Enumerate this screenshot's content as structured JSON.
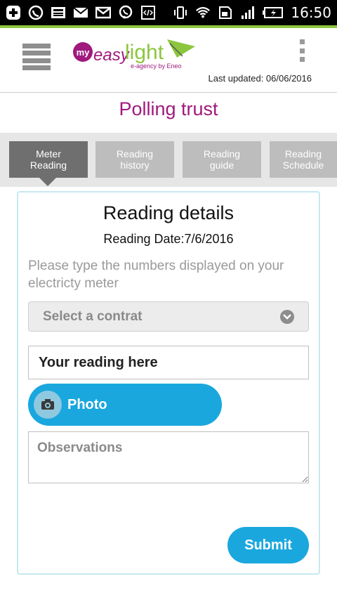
{
  "status_bar": {
    "time": "16:50",
    "icons": [
      "add-icon",
      "whatsapp-icon",
      "image-icon",
      "mail-icon",
      "gmail-icon",
      "viber-icon",
      "code-icon",
      "vibrate-icon",
      "wifi-icon",
      "sim-icon",
      "signal-icon",
      "battery-charging-icon"
    ]
  },
  "header": {
    "logo_text_my": "my",
    "logo_text_easy": "easy",
    "logo_text_light": "light",
    "logo_tagline": "e-agency by Eneo",
    "last_updated": "Last updated: 06/06/2016",
    "icons": {
      "menu": "hamburger-menu-icon",
      "overflow": "overflow-menu-icon"
    }
  },
  "page": {
    "title": "Polling trust"
  },
  "tabs": [
    {
      "line1": "Meter",
      "line2": "Reading",
      "active": true
    },
    {
      "line1": "Reading",
      "line2": "history",
      "active": false
    },
    {
      "line1": "Reading",
      "line2": "guide",
      "active": false
    },
    {
      "line1": "Reading",
      "line2": "Schedule",
      "active": false
    }
  ],
  "form": {
    "title": "Reading details",
    "reading_date": "Reading Date:7/6/2016",
    "instructions": "Please type the numbers displayed on your electricty meter",
    "select_contract": {
      "value": "Select a contrat",
      "icon": "chevron-down-icon"
    },
    "reading_input": {
      "placeholder": "Your reading here",
      "value": ""
    },
    "photo_button": {
      "label": "Photo",
      "icon": "camera-icon"
    },
    "observations": {
      "placeholder": "Observations",
      "value": ""
    },
    "submit_label": "Submit"
  },
  "colors": {
    "brand_magenta": "#a0197d",
    "brand_green": "#8cc63e",
    "accent_blue": "#1aa7de",
    "tab_active": "#6f6f6f",
    "tab_inactive": "#bdbdbd"
  }
}
